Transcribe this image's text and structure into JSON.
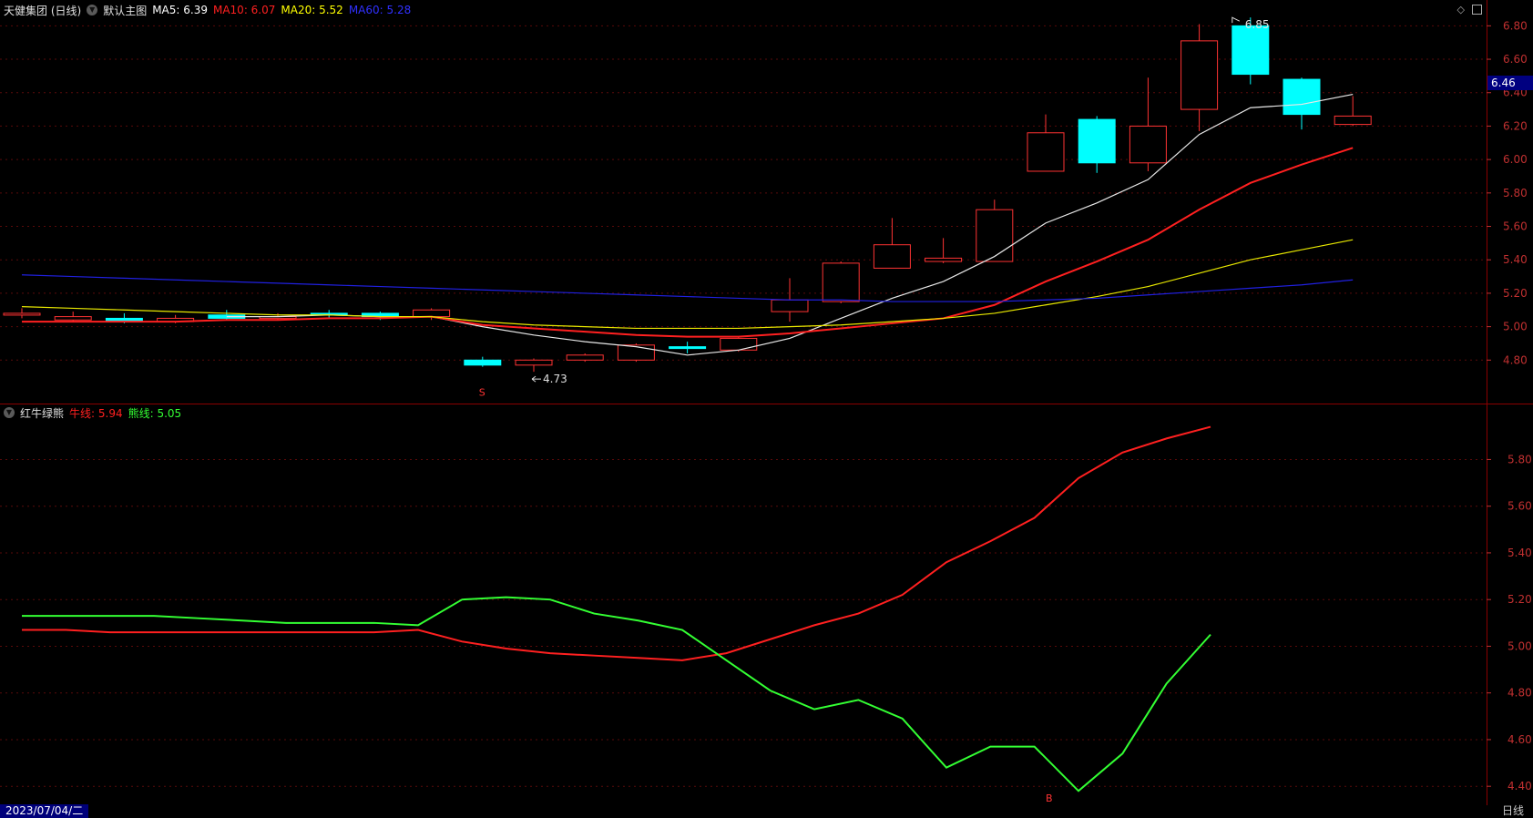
{
  "main": {
    "stock_title": "天健集团 (日线)",
    "indicator_name": "默认主图",
    "ma": [
      {
        "label": "MA5: 6.39",
        "color": "#ffffff"
      },
      {
        "label": "MA10: 6.07",
        "color": "#ff2020"
      },
      {
        "label": "MA20: 5.52",
        "color": "#ffff00"
      },
      {
        "label": "MA60: 5.28",
        "color": "#2020ff"
      }
    ],
    "current_price": "6.46",
    "high_marker": "6.85",
    "low_marker": "4.73",
    "signal_marker": "S"
  },
  "sub": {
    "indicator_name": "红牛绿熊",
    "bull_label": "牛线: 5.94",
    "bear_label": "熊线: 5.05",
    "bull_color": "#ff2020",
    "bear_color": "#33ff33",
    "signal_marker": "B"
  },
  "status": {
    "date": "2023/07/04/二",
    "period": "日线"
  },
  "colors": {
    "up": "#ff3333",
    "down": "#00ffff",
    "axis": "#c03030"
  },
  "chart_data": [
    {
      "type": "candlestick",
      "ylim": [
        4.6,
        6.9
      ],
      "y_ticks": [
        "6.80",
        "6.60",
        "6.40",
        "6.20",
        "6.00",
        "5.80",
        "5.60",
        "5.40",
        "5.20",
        "5.00",
        "4.80"
      ],
      "candles": [
        {
          "o": 5.08,
          "c": 5.08,
          "h": 5.11,
          "l": 5.05
        },
        {
          "o": 5.04,
          "c": 5.06,
          "h": 5.09,
          "l": 5.03
        },
        {
          "o": 5.05,
          "c": 5.03,
          "h": 5.08,
          "l": 5.02
        },
        {
          "o": 5.03,
          "c": 5.05,
          "h": 5.07,
          "l": 5.02
        },
        {
          "o": 5.07,
          "c": 5.05,
          "h": 5.1,
          "l": 5.04
        },
        {
          "o": 5.05,
          "c": 5.06,
          "h": 5.08,
          "l": 5.04
        },
        {
          "o": 5.08,
          "c": 5.07,
          "h": 5.1,
          "l": 5.05
        },
        {
          "o": 5.08,
          "c": 5.06,
          "h": 5.09,
          "l": 5.04
        },
        {
          "o": 5.06,
          "c": 5.1,
          "h": 5.11,
          "l": 5.04
        },
        {
          "o": 4.8,
          "c": 4.77,
          "h": 4.82,
          "l": 4.76
        },
        {
          "o": 4.77,
          "c": 4.8,
          "h": 4.81,
          "l": 4.73
        },
        {
          "o": 4.8,
          "c": 4.83,
          "h": 4.84,
          "l": 4.79
        },
        {
          "o": 4.8,
          "c": 4.89,
          "h": 4.9,
          "l": 4.79
        },
        {
          "o": 4.88,
          "c": 4.87,
          "h": 4.91,
          "l": 4.84
        },
        {
          "o": 4.86,
          "c": 4.93,
          "h": 4.94,
          "l": 4.85
        },
        {
          "o": 5.09,
          "c": 5.16,
          "h": 5.29,
          "l": 5.03
        },
        {
          "o": 5.15,
          "c": 5.38,
          "h": 5.39,
          "l": 5.14
        },
        {
          "o": 5.35,
          "c": 5.49,
          "h": 5.65,
          "l": 5.35
        },
        {
          "o": 5.39,
          "c": 5.41,
          "h": 5.53,
          "l": 5.38
        },
        {
          "o": 5.39,
          "c": 5.7,
          "h": 5.76,
          "l": 5.39
        },
        {
          "o": 5.93,
          "c": 6.16,
          "h": 6.27,
          "l": 5.93
        },
        {
          "o": 6.24,
          "c": 5.98,
          "h": 6.26,
          "l": 5.92
        },
        {
          "o": 5.98,
          "c": 6.2,
          "h": 6.49,
          "l": 5.93
        },
        {
          "o": 6.3,
          "c": 6.71,
          "h": 6.81,
          "l": 6.17
        },
        {
          "o": 6.8,
          "c": 6.51,
          "h": 6.85,
          "l": 6.45
        },
        {
          "o": 6.48,
          "c": 6.27,
          "h": 6.49,
          "l": 6.18
        },
        {
          "o": 6.21,
          "c": 6.26,
          "h": 6.38,
          "l": 6.2
        }
      ],
      "series": [
        {
          "name": "MA5",
          "values": [
            null,
            null,
            null,
            null,
            5.06,
            5.06,
            5.07,
            5.06,
            5.06,
            5.0,
            4.95,
            4.91,
            4.88,
            4.83,
            4.86,
            4.93,
            5.05,
            5.17,
            5.27,
            5.42,
            5.62,
            5.74,
            5.88,
            6.15,
            6.31,
            6.33,
            6.39
          ]
        },
        {
          "name": "MA10",
          "values": [
            5.03,
            5.03,
            5.03,
            5.03,
            5.04,
            5.04,
            5.05,
            5.05,
            5.06,
            5.01,
            4.99,
            4.97,
            4.95,
            4.94,
            4.94,
            4.96,
            4.99,
            5.02,
            5.05,
            5.13,
            5.27,
            5.39,
            5.52,
            5.7,
            5.86,
            5.97,
            6.07
          ]
        },
        {
          "name": "MA20",
          "values": [
            5.12,
            5.11,
            5.1,
            5.09,
            5.08,
            5.07,
            5.07,
            5.06,
            5.06,
            5.03,
            5.01,
            5.0,
            4.99,
            4.99,
            4.99,
            5.0,
            5.01,
            5.03,
            5.05,
            5.08,
            5.13,
            5.18,
            5.24,
            5.32,
            5.4,
            5.46,
            5.52
          ]
        },
        {
          "name": "MA60",
          "values": [
            5.31,
            5.3,
            5.29,
            5.28,
            5.27,
            5.26,
            5.25,
            5.24,
            5.23,
            5.22,
            5.21,
            5.2,
            5.19,
            5.18,
            5.17,
            5.16,
            5.16,
            5.15,
            5.15,
            5.15,
            5.16,
            5.17,
            5.19,
            5.21,
            5.23,
            5.25,
            5.28
          ]
        }
      ]
    },
    {
      "type": "line",
      "title": "红牛绿熊",
      "ylim": [
        4.35,
        5.95
      ],
      "y_ticks": [
        "5.80",
        "5.60",
        "5.40",
        "5.20",
        "5.00",
        "4.80",
        "4.60",
        "4.40"
      ],
      "series": [
        {
          "name": "牛线",
          "values": [
            5.07,
            5.07,
            5.06,
            5.06,
            5.06,
            5.06,
            5.06,
            5.06,
            5.06,
            5.07,
            5.02,
            4.99,
            4.97,
            4.96,
            4.95,
            4.94,
            4.97,
            5.03,
            5.09,
            5.14,
            5.22,
            5.36,
            5.45,
            5.55,
            5.72,
            5.83,
            5.89,
            5.94
          ]
        },
        {
          "name": "熊线",
          "values": [
            5.13,
            5.13,
            5.13,
            5.13,
            5.12,
            5.11,
            5.1,
            5.1,
            5.1,
            5.09,
            5.2,
            5.21,
            5.2,
            5.14,
            5.11,
            5.07,
            4.94,
            4.81,
            4.73,
            4.77,
            4.69,
            4.48,
            4.57,
            4.57,
            4.38,
            4.54,
            4.84,
            5.05
          ]
        }
      ]
    }
  ]
}
